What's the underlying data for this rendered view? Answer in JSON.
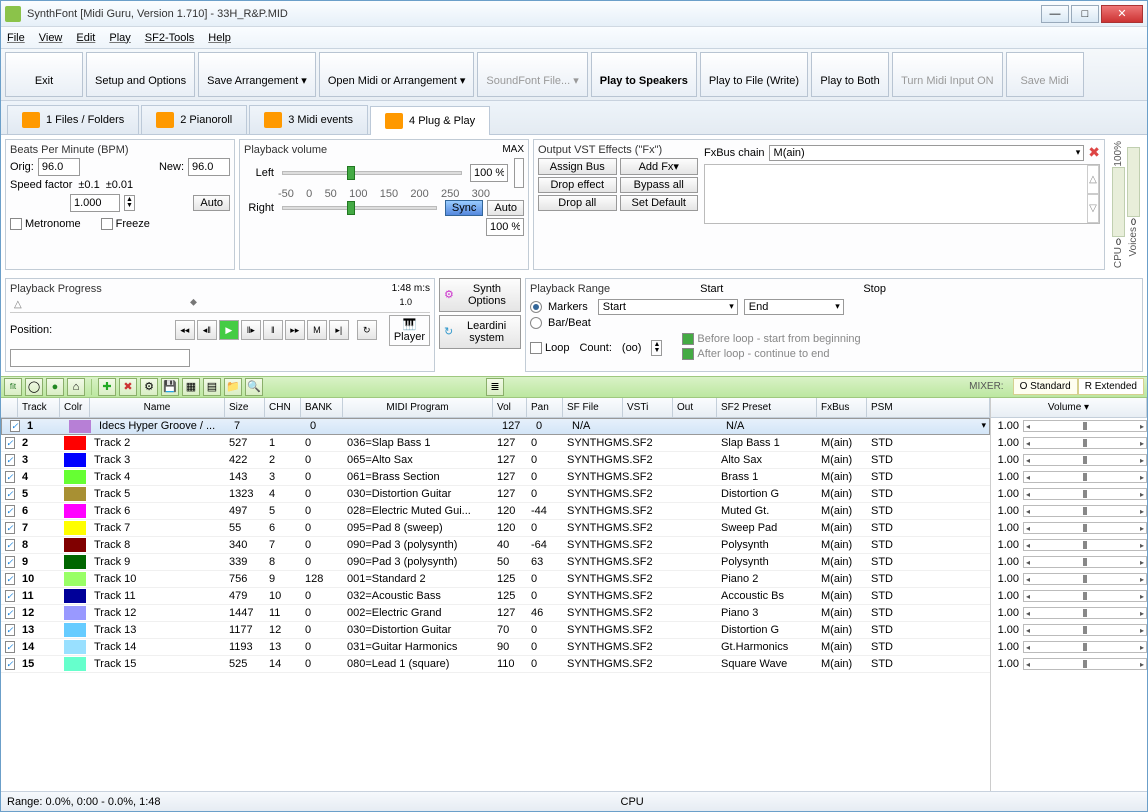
{
  "title": "SynthFont [Midi Guru, Version 1.710] - 33H_R&P.MID",
  "menu": [
    "File",
    "View",
    "Edit",
    "Play",
    "SF2-Tools",
    "Help"
  ],
  "toolbar": [
    {
      "label": "Exit",
      "icon": "exit-icon",
      "disabled": false
    },
    {
      "label": "Setup and Options",
      "icon": "setup-icon"
    },
    {
      "label": "Save Arrangement ▾",
      "icon": "save-icon"
    },
    {
      "label": "Open Midi or Arrangement ▾",
      "icon": "open-icon"
    },
    {
      "label": "SoundFont File... ▾",
      "icon": "sf-icon",
      "disabled": true
    },
    {
      "label": "Play to Speakers",
      "icon": "speaker-icon",
      "bold": true
    },
    {
      "label": "Play to File (Write)",
      "icon": "file-icon"
    },
    {
      "label": "Play to Both",
      "icon": "both-icon"
    },
    {
      "label": "Turn Midi Input ON",
      "icon": "midi-icon",
      "disabled": true
    },
    {
      "label": "Save Midi",
      "icon": "savemidi-icon",
      "disabled": true
    }
  ],
  "tabs": [
    {
      "label": "1 Files / Folders"
    },
    {
      "label": "2 Pianoroll"
    },
    {
      "label": "3 Midi events"
    },
    {
      "label": "4 Plug & Play",
      "active": true
    }
  ],
  "bpm": {
    "title": "Beats Per Minute (BPM)",
    "orig_label": "Orig:",
    "orig": "96.0",
    "new_label": "New:",
    "new": "96.0",
    "speed_label": "Speed factor",
    "speed_tol": "±0.1",
    "speed_fine": "±0.01",
    "speed_val": "1.000",
    "auto": "Auto",
    "metronome": "Metronome",
    "freeze": "Freeze"
  },
  "volume": {
    "title": "Playback volume",
    "max": "MAX",
    "left": "Left",
    "right": "Right",
    "pct_top": "100 %",
    "pct_bot": "100 %",
    "sync": "Sync",
    "auto": "Auto",
    "ticks": [
      "-50",
      "0",
      "50",
      "100",
      "150",
      "200",
      "250",
      "300"
    ]
  },
  "vst": {
    "title": "Output VST Effects (\"Fx\")",
    "assign": "Assign Bus",
    "addfx": "Add Fx▾",
    "drop_effect": "Drop effect",
    "bypass": "Bypass all",
    "drop_all": "Drop all",
    "setdef": "Set Default",
    "chain_label": "FxBus chain",
    "chain_val": "M(ain)"
  },
  "progress": {
    "title": "Playback Progress",
    "pos_label": "Position:",
    "time": "1:48 m:s",
    "rate": "1.0"
  },
  "synth": {
    "opt": "Synth Options",
    "player": "Player",
    "leardini": "Leardini system"
  },
  "range": {
    "title": "Playback Range",
    "markers": "Markers",
    "barbeat": "Bar/Beat",
    "start_label": "Start",
    "stop_label": "Stop",
    "start": "Start",
    "stop": "End",
    "loop": "Loop",
    "count_label": "Count:",
    "count": "(oo)",
    "before": "Before loop - start from beginning",
    "after": "After loop - continue to end"
  },
  "meters": {
    "pct": "100%",
    "zero": "0",
    "cpu": "CPU",
    "voices": "Voices",
    "vzero": "0"
  },
  "mixer": {
    "label": "MIXER:",
    "std": "O Standard",
    "ext": "R Extended",
    "vol": "Volume ▾"
  },
  "cols": {
    "track": "Track",
    "color": "Colr",
    "name": "Name",
    "size": "Size",
    "chn": "CHN",
    "bank": "BANK",
    "prog": "MIDI Program",
    "vol": "Vol",
    "pan": "Pan",
    "sf": "SF File",
    "vsti": "VSTi",
    "out": "Out",
    "preset": "SF2 Preset",
    "fxbus": "FxBus",
    "psm": "PSM"
  },
  "tracks": [
    {
      "n": 1,
      "c": "#b77fd6",
      "name": "Idecs Hyper Groove / ...",
      "size": 7,
      "chn": "",
      "bank": 0,
      "prog": "",
      "vol": 127,
      "pan": 0,
      "sf": "N/A",
      "preset": "N/A",
      "fx": "",
      "psm": "",
      "sel": true
    },
    {
      "n": 2,
      "c": "#ff0000",
      "name": "Track 2",
      "size": 527,
      "chn": 1,
      "bank": 0,
      "prog": "036=Slap Bass 1",
      "vol": 127,
      "pan": 0,
      "sf": "SYNTHGMS.SF2",
      "preset": "Slap Bass 1",
      "fx": "M(ain)",
      "psm": "STD"
    },
    {
      "n": 3,
      "c": "#0000ff",
      "name": "Track 3",
      "size": 422,
      "chn": 2,
      "bank": 0,
      "prog": "065=Alto Sax",
      "vol": 127,
      "pan": 0,
      "sf": "SYNTHGMS.SF2",
      "preset": "Alto Sax",
      "fx": "M(ain)",
      "psm": "STD"
    },
    {
      "n": 4,
      "c": "#66ff33",
      "name": "Track 4",
      "size": 143,
      "chn": 3,
      "bank": 0,
      "prog": "061=Brass Section",
      "vol": 127,
      "pan": 0,
      "sf": "SYNTHGMS.SF2",
      "preset": "Brass 1",
      "fx": "M(ain)",
      "psm": "STD"
    },
    {
      "n": 5,
      "c": "#a89033",
      "name": "Track 5",
      "size": 1323,
      "chn": 4,
      "bank": 0,
      "prog": "030=Distortion Guitar",
      "vol": 127,
      "pan": 0,
      "sf": "SYNTHGMS.SF2",
      "preset": "Distortion G",
      "fx": "M(ain)",
      "psm": "STD"
    },
    {
      "n": 6,
      "c": "#ff00ff",
      "name": "Track 6",
      "size": 497,
      "chn": 5,
      "bank": 0,
      "prog": "028=Electric Muted Gui...",
      "vol": 120,
      "pan": -44,
      "sf": "SYNTHGMS.SF2",
      "preset": "Muted Gt.",
      "fx": "M(ain)",
      "psm": "STD"
    },
    {
      "n": 7,
      "c": "#ffff00",
      "name": "Track 7",
      "size": 55,
      "chn": 6,
      "bank": 0,
      "prog": "095=Pad 8 (sweep)",
      "vol": 120,
      "pan": 0,
      "sf": "SYNTHGMS.SF2",
      "preset": "Sweep Pad",
      "fx": "M(ain)",
      "psm": "STD"
    },
    {
      "n": 8,
      "c": "#800000",
      "name": "Track 8",
      "size": 340,
      "chn": 7,
      "bank": 0,
      "prog": "090=Pad 3 (polysynth)",
      "vol": 40,
      "pan": -64,
      "sf": "SYNTHGMS.SF2",
      "preset": "Polysynth",
      "fx": "M(ain)",
      "psm": "STD"
    },
    {
      "n": 9,
      "c": "#006600",
      "name": "Track 9",
      "size": 339,
      "chn": 8,
      "bank": 0,
      "prog": "090=Pad 3 (polysynth)",
      "vol": 50,
      "pan": 63,
      "sf": "SYNTHGMS.SF2",
      "preset": "Polysynth",
      "fx": "M(ain)",
      "psm": "STD"
    },
    {
      "n": 10,
      "c": "#99ff66",
      "name": "Track 10",
      "size": 756,
      "chn": 9,
      "bank": 128,
      "prog": "001=Standard 2",
      "vol": 125,
      "pan": 0,
      "sf": "SYNTHGMS.SF2",
      "preset": "Piano 2",
      "fx": "M(ain)",
      "psm": "STD"
    },
    {
      "n": 11,
      "c": "#000099",
      "name": "Track 11",
      "size": 479,
      "chn": 10,
      "bank": 0,
      "prog": "032=Acoustic Bass",
      "vol": 125,
      "pan": 0,
      "sf": "SYNTHGMS.SF2",
      "preset": "Accoustic Bs",
      "fx": "M(ain)",
      "psm": "STD"
    },
    {
      "n": 12,
      "c": "#9999ff",
      "name": "Track 12",
      "size": 1447,
      "chn": 11,
      "bank": 0,
      "prog": "002=Electric Grand",
      "vol": 127,
      "pan": 46,
      "sf": "SYNTHGMS.SF2",
      "preset": "Piano 3",
      "fx": "M(ain)",
      "psm": "STD"
    },
    {
      "n": 13,
      "c": "#66ccff",
      "name": "Track 13",
      "size": 1177,
      "chn": 12,
      "bank": 0,
      "prog": "030=Distortion Guitar",
      "vol": 70,
      "pan": 0,
      "sf": "SYNTHGMS.SF2",
      "preset": "Distortion G",
      "fx": "M(ain)",
      "psm": "STD"
    },
    {
      "n": 14,
      "c": "#99e0ff",
      "name": "Track 14",
      "size": 1193,
      "chn": 13,
      "bank": 0,
      "prog": "031=Guitar Harmonics",
      "vol": 90,
      "pan": 0,
      "sf": "SYNTHGMS.SF2",
      "preset": "Gt.Harmonics",
      "fx": "M(ain)",
      "psm": "STD"
    },
    {
      "n": 15,
      "c": "#66ffcc",
      "name": "Track 15",
      "size": 525,
      "chn": 14,
      "bank": 0,
      "prog": "080=Lead 1 (square)",
      "vol": 110,
      "pan": 0,
      "sf": "SYNTHGMS.SF2",
      "preset": "Square Wave",
      "fx": "M(ain)",
      "psm": "STD"
    }
  ],
  "mixer_vals": [
    "1.00",
    "1.00",
    "1.00",
    "1.00",
    "1.00",
    "1.00",
    "1.00",
    "1.00",
    "1.00",
    "1.00",
    "1.00",
    "1.00",
    "1.00",
    "1.00",
    "1.00"
  ],
  "status": {
    "range": "Range: 0.0%, 0:00 - 0.0%, 1:48",
    "cpu": "CPU"
  }
}
